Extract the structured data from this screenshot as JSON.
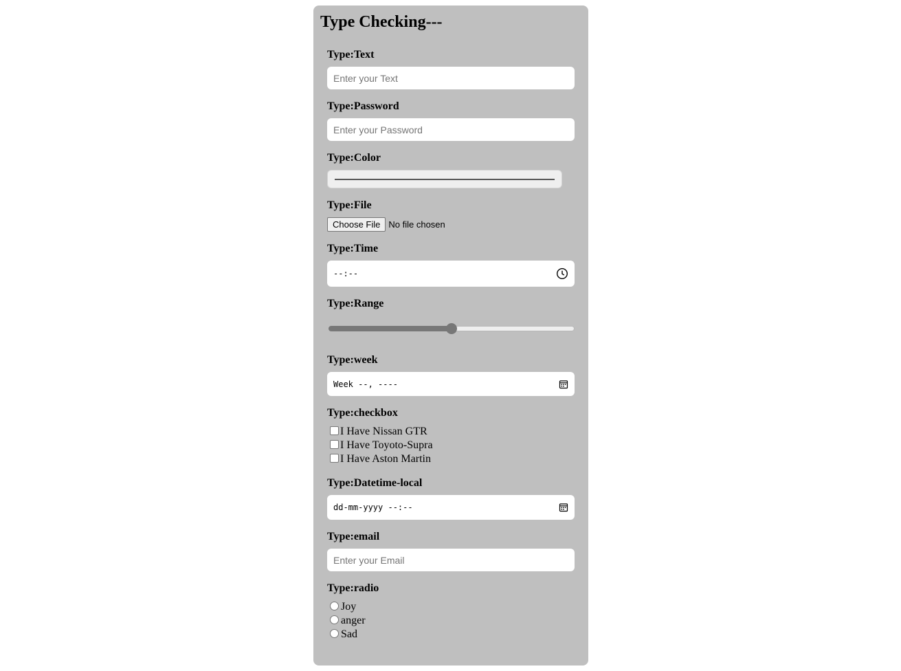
{
  "title": "Type Checking---",
  "fields": {
    "text": {
      "label": "Type:Text",
      "placeholder": "Enter your Text"
    },
    "password": {
      "label": "Type:Password",
      "placeholder": "Enter your Password"
    },
    "color": {
      "label": "Type:Color",
      "value": "#000000"
    },
    "file": {
      "label": "Type:File",
      "button": "Choose File",
      "status": "No file chosen"
    },
    "time": {
      "label": "Type:Time",
      "value": "--:--",
      "icon": "clock-icon"
    },
    "range": {
      "label": "Type:Range",
      "value": 50,
      "min": 0,
      "max": 100
    },
    "week": {
      "label": "Type:week",
      "value": "Week --, ----",
      "icon": "calendar-icon"
    },
    "checkbox": {
      "label": "Type:checkbox",
      "options": [
        "I Have Nissan GTR",
        "I Have Toyoto-Supra",
        "I Have Aston Martin"
      ]
    },
    "datetime": {
      "label": "Type:Datetime-local",
      "value": "dd-mm-yyyy --:--",
      "icon": "calendar-icon"
    },
    "email": {
      "label": "Type:email",
      "placeholder": "Enter your Email"
    },
    "radio": {
      "label": "Type:radio",
      "options": [
        "Joy",
        "anger",
        "Sad"
      ]
    }
  },
  "colors": {
    "card_background": "#bfbfbf",
    "range_fill": "#777777"
  }
}
